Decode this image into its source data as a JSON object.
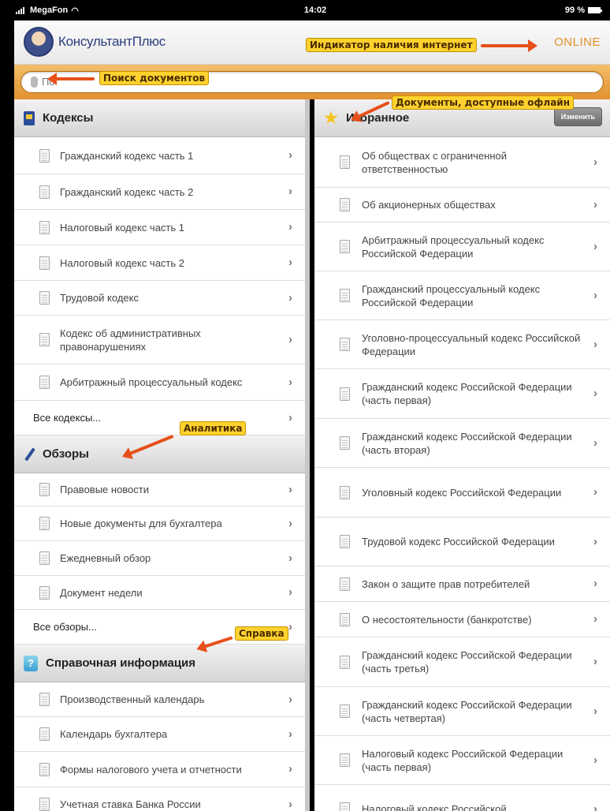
{
  "status_bar": {
    "carrier": "MegaFon",
    "time": "14:02",
    "battery": "99 %"
  },
  "header": {
    "logo_text": "КонсультантПлюс",
    "online": "ONLINE"
  },
  "search": {
    "placeholder": "По"
  },
  "annotations": {
    "internet": "Индикатор наличия интернет",
    "search": "Поиск документов",
    "offline": "Документы, доступные офлайн",
    "analytics": "Аналитика",
    "help": "Справка"
  },
  "left": {
    "codes": {
      "title": "Кодексы",
      "items": [
        "Гражданский кодекс часть 1",
        "Гражданский кодекс часть 2",
        "Налоговый кодекс часть 1",
        "Налоговый кодекс часть 2",
        "Трудовой кодекс",
        "Кодекс об административных правонарушениях",
        "Арбитражный процессуальный кодекс"
      ],
      "all": "Все кодексы..."
    },
    "reviews": {
      "title": "Обзоры",
      "items": [
        "Правовые новости",
        "Новые документы для бухгалтера",
        "Ежедневный обзор",
        "Документ недели"
      ],
      "all": "Все обзоры..."
    },
    "reference": {
      "title": "Справочная информация",
      "items": [
        "Производственный календарь",
        "Календарь бухгалтера",
        "Формы налогового учета и отчетности",
        "Учетная ставка Банка России"
      ]
    }
  },
  "right": {
    "favorites": {
      "title": "Избранное",
      "edit_label": "Изменить",
      "items": [
        "Об обществах с ограниченной ответственностью",
        "Об акционерных обществах",
        "Арбитражный процессуальный кодекс Российской Федерации",
        "Гражданский процессуальный кодекс Российской Федерации",
        "Уголовно-процессуальный кодекс Российской Федерации",
        "Гражданский кодекс Российской Федерации (часть первая)",
        "Гражданский кодекс Российской Федерации (часть вторая)",
        "Уголовный кодекс Российской Федерации",
        "Трудовой кодекс Российской Федерации",
        "Закон о защите прав потребителей",
        "О несостоятельности (банкротстве)",
        "Гражданский кодекс Российской Федерации (часть третья)",
        "Гражданский кодекс Российской Федерации (часть четвертая)",
        "Налоговый кодекс Российской Федерации (часть первая)",
        "Налоговый кодекс Российской"
      ]
    }
  },
  "colors": {
    "accent_orange": "#e3912a",
    "annotation_arrow": "#e6501a",
    "annotation_label": "#ffd22e"
  },
  "icons": {
    "doc": "document-icon",
    "chevron": "chevron-right-icon",
    "codes": "book-icon",
    "reviews": "pencil-icon",
    "reference": "help-icon",
    "favorites": "star-icon"
  }
}
